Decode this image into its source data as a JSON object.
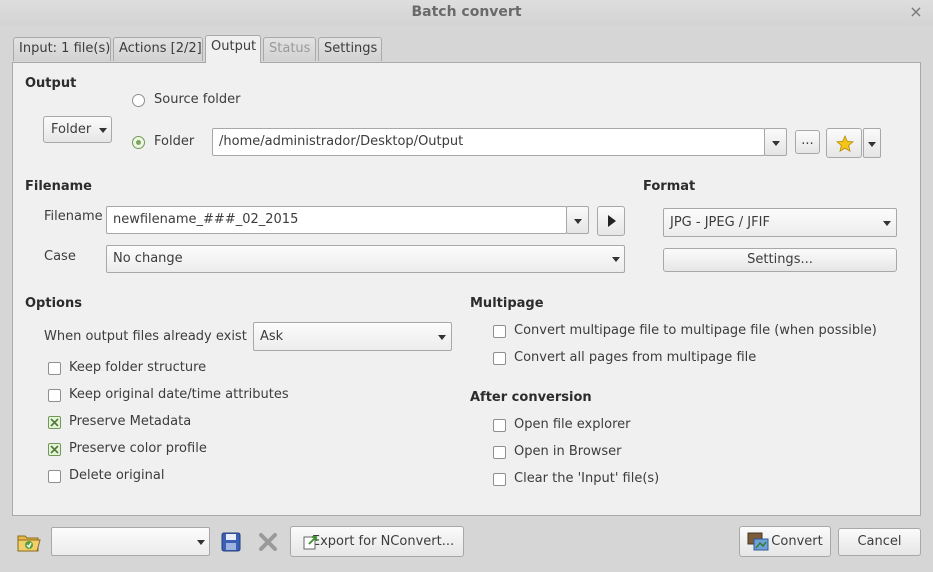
{
  "window": {
    "title": "Batch convert",
    "close_glyph": "×"
  },
  "tabs": [
    {
      "label": "Input: 1 file(s)"
    },
    {
      "label": "Actions [2/2]"
    },
    {
      "label": "Output"
    },
    {
      "label": "Status"
    },
    {
      "label": "Settings"
    }
  ],
  "output": {
    "section_title": "Output",
    "mode_button": "Folder",
    "source_folder_label": "Source folder",
    "folder_label": "Folder",
    "folder_path": "/home/administrador/Desktop/Output",
    "browse_label": "..."
  },
  "filename": {
    "section_title": "Filename",
    "filename_label": "Filename",
    "filename_value": "newfilename_###_02_2015",
    "case_label": "Case",
    "case_value": "No change"
  },
  "format": {
    "section_title": "Format",
    "value": "JPG - JPEG / JFIF",
    "settings_label": "Settings..."
  },
  "options": {
    "section_title": "Options",
    "exist_label": "When output files already exist",
    "exist_value": "Ask",
    "checks": [
      {
        "label": "Keep folder structure",
        "checked": false
      },
      {
        "label": "Keep original date/time attributes",
        "checked": false
      },
      {
        "label": "Preserve Metadata",
        "checked": true
      },
      {
        "label": "Preserve color profile",
        "checked": true
      },
      {
        "label": "Delete original",
        "checked": false
      }
    ]
  },
  "multipage": {
    "section_title": "Multipage",
    "checks": [
      {
        "label": "Convert multipage file to multipage file (when possible)",
        "checked": false
      },
      {
        "label": "Convert all pages from multipage file",
        "checked": false
      }
    ]
  },
  "after": {
    "section_title": "After conversion",
    "checks": [
      {
        "label": "Open file explorer",
        "checked": false
      },
      {
        "label": "Open in Browser",
        "checked": false
      },
      {
        "label": "Clear the 'Input' file(s)",
        "checked": false
      }
    ]
  },
  "bottom": {
    "export_label": "Export for NConvert...",
    "convert_label": "Convert",
    "cancel_label": "Cancel"
  }
}
